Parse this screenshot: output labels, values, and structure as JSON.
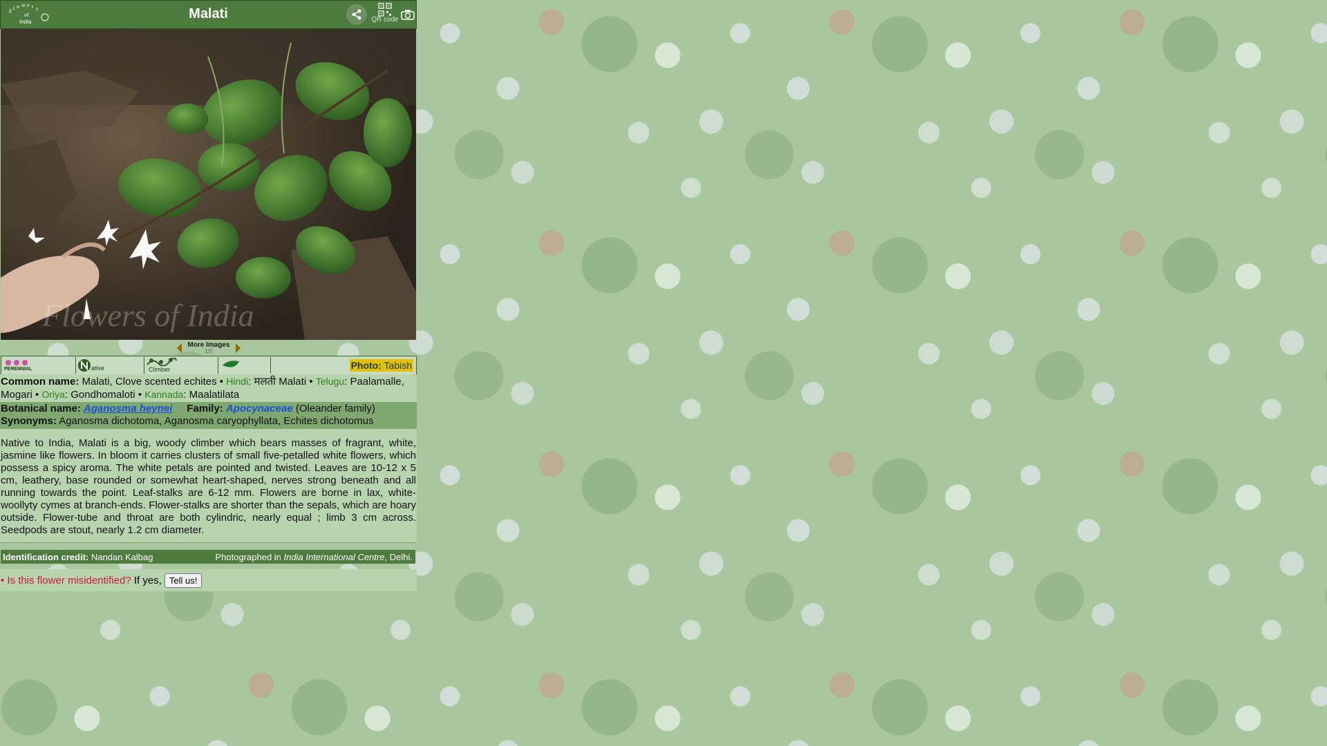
{
  "header": {
    "title": "Malati",
    "logo_text": [
      "F",
      "l",
      "o",
      "w",
      "e",
      "r",
      "s",
      "of",
      "India"
    ],
    "qr_label": "QR code"
  },
  "gallery": {
    "more_images_label": "More Images",
    "image_count": "1/5",
    "watermark": "Flowers of India"
  },
  "attributes": {
    "perennial": "PERENNIAL",
    "native": "ative",
    "climber": "Climber",
    "photo_label": "Photo:",
    "photographer": "Tabish"
  },
  "names": {
    "common_label": "Common name:",
    "common_value": "Malati, Clove scented echites",
    "hindi_label": "Hindi",
    "hindi_value": "मलती Malati",
    "telugu_label": "Telugu",
    "telugu_value": "Paalamalle, Mogari",
    "oriya_label": "Oriya",
    "oriya_value": "Gondhomaloti",
    "kannada_label": "Kannada",
    "kannada_value": "Maalatilata",
    "botanical_label": "Botanical name:",
    "botanical_value": "Aganosma heynei",
    "family_label": "Family:",
    "family_value": "Apocynaceae",
    "family_common": "(Oleander family)",
    "synonyms_label": "Synonyms:",
    "synonyms_value": "Aganosma dichotoma, Aganosma caryophyllata, Echites dichotomus"
  },
  "description": "Native to India, Malati is a big, woody climber which bears masses of fragrant, white, jasmine like flowers. In bloom it carries clusters of small five-petalled white flowers, which possess a spicy aroma. The white petals are pointed and twisted. Leaves are 10-12 x 5 cm, leathery, base rounded or somewhat heart-shaped, nerves strong beneath and all running towards the point. Leaf-stalks are 6-12 mm. Flowers are borne in lax, white-woollyty cymes at branch-ends. Flower-stalks are shorter than the sepals, which are hoary outside. Flower-tube and throat are both cylindric, nearly equal ; limb 3 cm across. Seedpods are stout, nearly 1.2 cm diameter.",
  "credit": {
    "id_label": "Identification credit:",
    "id_value": "Nandan Kalbag",
    "photographed_prefix": "Photographed in",
    "location": "India International Centre",
    "location_suffix": ", Delhi."
  },
  "feedback": {
    "question": "• Is this flower misidentified?",
    "if_yes": "If yes,",
    "button": "Tell us!"
  },
  "colors": {
    "header_green": "#4d7a3d",
    "light_green": "#b7d4af",
    "mid_green": "#7ea86f",
    "link_blue": "#1c4fd8",
    "alert_red": "#d0163d",
    "photo_highlight": "#e5c000"
  }
}
